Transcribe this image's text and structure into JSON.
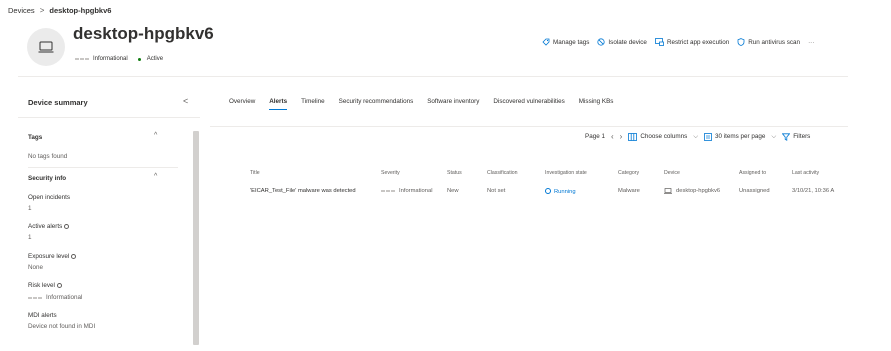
{
  "breadcrumb": {
    "parent": "Devices",
    "separator": ">",
    "current": "desktop-hpgbkv6"
  },
  "header": {
    "device_name": "desktop-hpgbkv6",
    "severity": "Informational",
    "status": "Active",
    "actions": [
      {
        "label": "Manage tags",
        "icon": "tag-icon"
      },
      {
        "label": "Isolate device",
        "icon": "block-icon"
      },
      {
        "label": "Restrict app execution",
        "icon": "restrict-app-icon"
      },
      {
        "label": "Run antivirus scan",
        "icon": "shield-icon"
      },
      {
        "label": "···",
        "icon": "more-icon"
      }
    ]
  },
  "summary": {
    "title": "Device summary",
    "collapse_glyph": "<",
    "tags_heading": "Tags",
    "tags_value": "No tags found",
    "security_heading": "Security info",
    "fields": [
      {
        "label": "Open incidents",
        "value": "1",
        "info": false
      },
      {
        "label": "Active alerts",
        "value": "1",
        "info": true
      },
      {
        "label": "Exposure level",
        "value": "None",
        "info": true
      },
      {
        "label": "Risk level",
        "value": "Informational",
        "info": true,
        "bars": true
      },
      {
        "label": "MDI alerts",
        "value": "Device not found in MDI",
        "info": false
      }
    ]
  },
  "tabs": [
    {
      "label": "Overview",
      "active": false
    },
    {
      "label": "Alerts",
      "active": true
    },
    {
      "label": "Timeline",
      "active": false
    },
    {
      "label": "Security recommendations",
      "active": false
    },
    {
      "label": "Software inventory",
      "active": false
    },
    {
      "label": "Discovered vulnerabilities",
      "active": false
    },
    {
      "label": "Missing KBs",
      "active": false
    }
  ],
  "grid_toolbar": {
    "page": "Page 1",
    "choose_columns": "Choose columns",
    "items_per_page": "30 items per page",
    "filters": "Filters"
  },
  "table": {
    "columns": [
      "Title",
      "Severity",
      "Status",
      "Classification",
      "Investigation state",
      "Category",
      "Device",
      "Assigned to",
      "Last activity"
    ],
    "rows": [
      {
        "title": "'EICAR_Test_File' malware was detected",
        "severity": "Informational",
        "status": "New",
        "classification": "Not set",
        "investigation_state": "Running",
        "category": "Malware",
        "device": "desktop-hpgbkv6",
        "assigned_to": "Unassigned",
        "last_activity": "3/10/21, 10:36 A"
      }
    ]
  },
  "colors": {
    "accent": "#0078d4",
    "active_status": "#107c10",
    "severity_bars": "#c8c6c4"
  }
}
